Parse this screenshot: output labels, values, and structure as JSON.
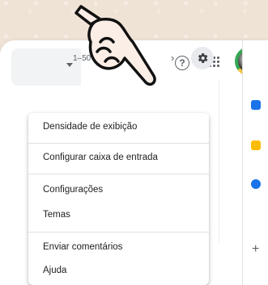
{
  "toolbar": {
    "help_glyph": "?",
    "pagination": "1–50 de 63",
    "prev_glyph": "‹",
    "next_glyph": "›"
  },
  "menu": {
    "items": [
      "Densidade de exibição",
      "Configurar caixa de entrada",
      "Configurações",
      "Temas",
      "Enviar comentários",
      "Ajuda"
    ]
  },
  "side_panel": {
    "add_glyph": "+"
  },
  "colors": {
    "calendar": "#1a73e8",
    "keep": "#fbbc04",
    "tasks": "#1a73e8",
    "gear_bg": "#e8eaed"
  }
}
